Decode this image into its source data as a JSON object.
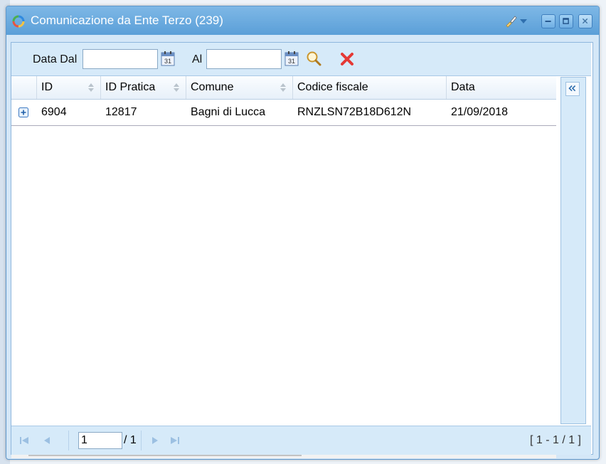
{
  "window": {
    "title": "Comunicazione da Ente Terzo (239)"
  },
  "filters": {
    "from_label": "Data Dal",
    "from_value": "",
    "to_label": "Al",
    "to_value": ""
  },
  "grid": {
    "columns": [
      "ID",
      "ID Pratica",
      "Comune",
      "Codice fiscale",
      "Data"
    ],
    "rows": [
      {
        "id": "6904",
        "id_pratica": "12817",
        "comune": "Bagni di Lucca",
        "codice_fiscale": "RNZLSN72B18D612N",
        "data": "21/09/2018"
      }
    ]
  },
  "pager": {
    "page": "1",
    "total": "/ 1",
    "range": "[ 1 - 1 / 1 ]"
  },
  "colors": {
    "title_bar": "#5b9fd8",
    "accent": "#2f6fae",
    "clear": "#e53935"
  },
  "icons": [
    "app-logo-icon",
    "brush-icon",
    "minimize-icon",
    "maximize-icon",
    "close-icon",
    "calendar-icon",
    "search-icon",
    "clear-filter-icon",
    "expand-row-icon",
    "collapse-panel-icon",
    "first-page-icon",
    "prev-page-icon",
    "next-page-icon",
    "last-page-icon"
  ]
}
